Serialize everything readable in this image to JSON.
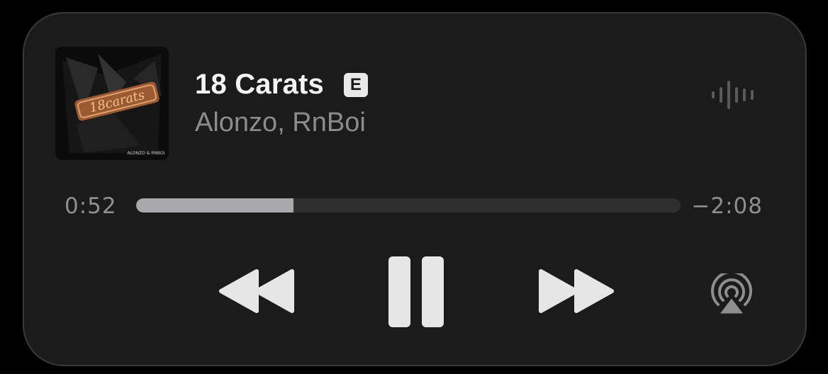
{
  "track": {
    "title": "18 Carats",
    "explicit_badge": "E",
    "artist": "Alonzo, RnBoi",
    "artwork_text": "ALONZO & RNBOI"
  },
  "progress": {
    "elapsed": "0:52",
    "remaining": "−2:08",
    "fraction": 0.289
  },
  "controls": {
    "rewind": "rewind-icon",
    "pause": "pause-icon",
    "forward": "fast-forward-icon",
    "airplay": "airplay-icon",
    "waveform": "waveform-icon"
  },
  "colors": {
    "background": "#1b1b1b",
    "progress_fill": "#a8a8ad",
    "progress_track": "#2f2f2f",
    "title": "#f4f4f4",
    "artist": "#8c8c8c"
  }
}
